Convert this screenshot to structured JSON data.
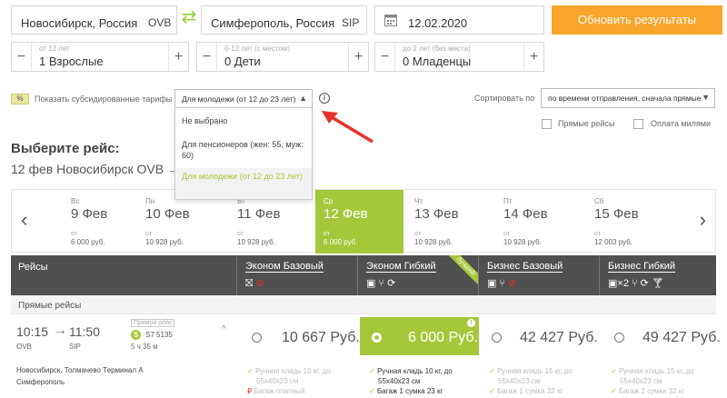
{
  "search": {
    "from_city": "Новосибирск, Россия",
    "from_code": "OVB",
    "to_city": "Симферополь, Россия",
    "to_code": "SIP",
    "date": "12.02.2020",
    "update_button": "Обновить результаты"
  },
  "passengers": [
    {
      "sub": "от 12 лет",
      "value": "1 Взрослые"
    },
    {
      "sub": "0-12 лет (с местом)",
      "value": "0 Дети"
    },
    {
      "sub": "до 2 лет (без места)",
      "value": "0 Младенцы"
    }
  ],
  "filters": {
    "badge": "%",
    "subsidized_label": "Показать субсидированные тарифы",
    "subsidized_selected": "Для молодежи (от 12 до 23 лет)",
    "sort_label": "Сортировать по",
    "sort_value": "по времени отправления, сначала прямые",
    "direct_flights": "Прямые рейсы",
    "pay_miles": "Оплата милями"
  },
  "dropdown_options": [
    "Не выбрано",
    "Для пенсионеров (жен: 55, муж: 60)",
    "Для молодежи (от 12 до 23 лет)"
  ],
  "selection": {
    "heading": "Выберите рейс:",
    "route": "12 фев Новосибирск OVB →"
  },
  "dates": [
    {
      "dow": "Вс",
      "date": "9 Фев",
      "ot": "от",
      "price": "6 000 руб."
    },
    {
      "dow": "Пн",
      "date": "10 Фев",
      "ot": "от",
      "price": "10 928 руб."
    },
    {
      "dow": "Вт",
      "date": "11 Фев",
      "ot": "от",
      "price": "10 928 руб."
    },
    {
      "dow": "Ср",
      "date": "12 Фев",
      "ot": "от",
      "price": "6 000 руб."
    },
    {
      "dow": "Чт",
      "date": "13 Фев",
      "ot": "от",
      "price": "10 928 руб."
    },
    {
      "dow": "Пт",
      "date": "14 Фев",
      "ot": "от",
      "price": "10 928 руб."
    },
    {
      "dow": "Сб",
      "date": "15 Фев",
      "ot": "от",
      "price": "12 003 руб."
    }
  ],
  "table": {
    "flights_header": "Рейсы",
    "fares": [
      "Эконом Базовый",
      "Эконом Гибкий",
      "Бизнес Базовый",
      "Бизнес Гибкий"
    ],
    "best_ribbon": "Лучший!",
    "business_flex_icon_text": "×2",
    "section": "Прямые рейсы"
  },
  "flight": {
    "dep_time": "10:15",
    "arr_time": "11:50",
    "dep_code": "OVB",
    "arr_code": "SIP",
    "badge": "Прямой рейс",
    "flight_no": "S7 5135",
    "duration": "5 ч 35 м",
    "from_airport": "Новосибирск, Толмачево Терминал А",
    "to_airport": "Симферополь",
    "prices": [
      "10 667 Руб.",
      "6 000 Руб.",
      "42 427 Руб.",
      "49 427 Руб."
    ],
    "features": [
      {
        "l1": "Ручная кладь 10 кг, до",
        "l2": "55x40x23 см",
        "l3": "Багаж платный"
      },
      {
        "l1": "Ручная кладь 10 кг, до",
        "l2": "55x40x23 см",
        "l3": "Багаж 1 сумка 23 кг"
      },
      {
        "l1": "Ручная кладь 15 кг, до",
        "l2": "55x40x23 см",
        "l3": "Багаж 1 сумка 32 кг"
      },
      {
        "l1": "Ручная кладь 15 кг, до",
        "l2": "55x40x23 см",
        "l3": "Багаж 2 сумки 32 кг"
      }
    ]
  },
  "colors": {
    "accent": "#a5c83a",
    "orange": "#f7a52b",
    "header": "#505050",
    "arrow": "#e8312a"
  }
}
